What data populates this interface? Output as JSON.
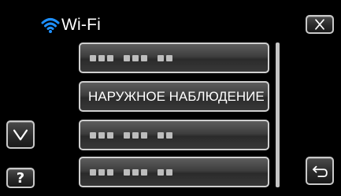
{
  "header": {
    "title": "Wi-Fi",
    "icon": "wifi-icon"
  },
  "buttons": {
    "close_icon": "close-icon",
    "down_icon": "chevron-down-icon",
    "help_label": "?",
    "back_icon": "back-arrow-icon"
  },
  "list": {
    "items": [
      {
        "label": "",
        "masked": true
      },
      {
        "label": "НАРУЖНОЕ НАБЛЮДЕНИЕ",
        "masked": false
      },
      {
        "label": "",
        "masked": true
      },
      {
        "label": "",
        "masked": true
      }
    ]
  },
  "colors": {
    "background": "#000000",
    "wifi_icon": "#1e90ff",
    "button_border": "#c9c9c9"
  }
}
